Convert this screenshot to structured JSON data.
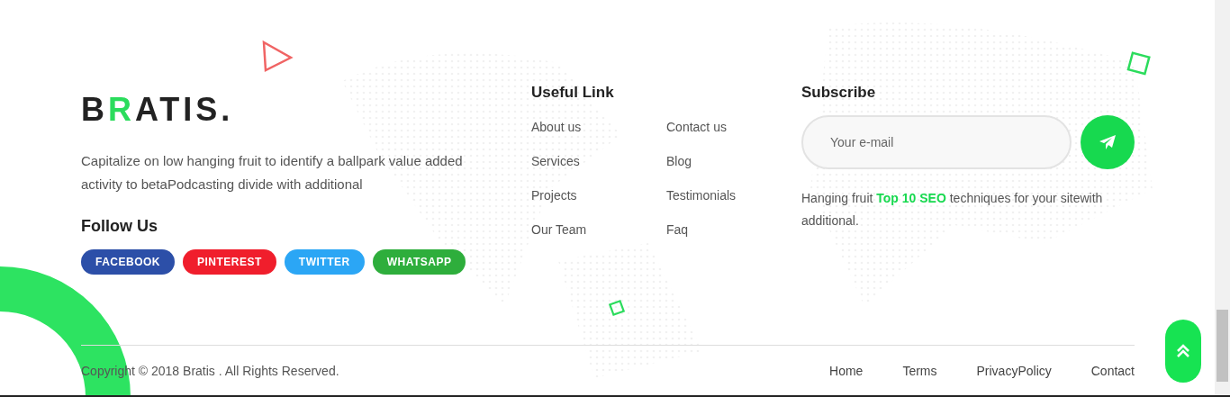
{
  "logo": {
    "parts": [
      {
        "text": "B",
        "color": "#222222"
      },
      {
        "text": "R",
        "color": "#2bdc5c"
      },
      {
        "text": "ATIS.",
        "color": "#222222"
      }
    ]
  },
  "about": "Capitalize on low hanging fruit to identify a ballpark value added activity to betaPodcasting divide with additional",
  "follow": {
    "title": "Follow Us",
    "buttons": [
      {
        "label": "FACEBOOK",
        "color": "#2c4fa8"
      },
      {
        "label": "PINTEREST",
        "color": "#f01e2c"
      },
      {
        "label": "TWITTER",
        "color": "#2ba6f5"
      },
      {
        "label": "WHATSAPP",
        "color": "#2eae3c"
      }
    ]
  },
  "useful_link": {
    "title": "Useful Link",
    "columns": [
      [
        "About us",
        "Services",
        "Projects",
        "Our Team"
      ],
      [
        "Contact us",
        "Blog",
        "Testimonials",
        "Faq"
      ]
    ]
  },
  "subscribe": {
    "title": "Subscribe",
    "placeholder": "Your e-mail",
    "note": "Hanging fruit **Top 10 SEO** techniques for your sitewith additional."
  },
  "copyright": "Copyright © 2018 Bratis . All Rights Reserved.",
  "bottom_links": [
    "Home",
    "Terms",
    "PrivacyPolicy",
    "Contact"
  ]
}
